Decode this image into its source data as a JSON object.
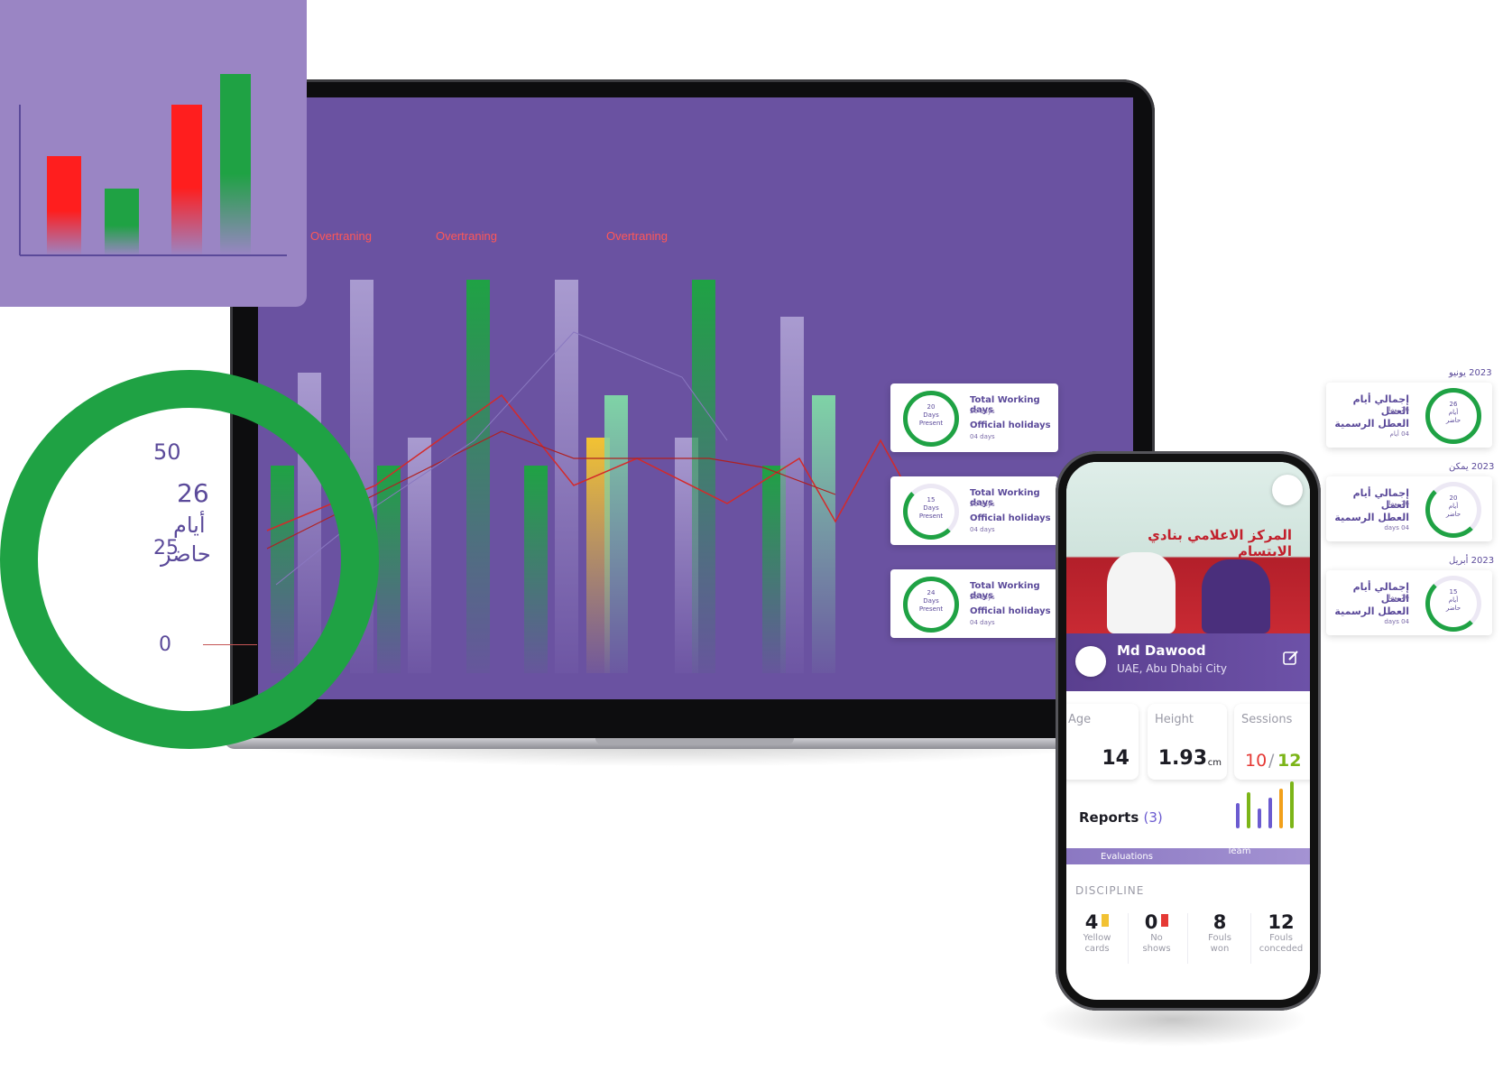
{
  "colors": {
    "brand_purple": "#6a52a1",
    "green": "#1fa244",
    "red": "#ff1e1e",
    "yellow": "#f2c233",
    "lavender": "#9a85c4",
    "ink": "#5b4a9a"
  },
  "laptop": {
    "overtraining_labels": [
      "Overtraning",
      "Overtraning",
      "Overtraning"
    ]
  },
  "big_ring": {
    "tick_top": "50",
    "tick_mid": "25",
    "tick_bottom": "0",
    "value": "26",
    "unit_line1": "أيام",
    "unit_line2": "حاضر"
  },
  "attendance_cards": [
    {
      "ring_line1": "20",
      "ring_line2": "Days",
      "ring_line3": "Present",
      "working_label": "Total Working days",
      "working_value": "26 days",
      "holiday_label": "Official holidays",
      "holiday_value": "04 days"
    },
    {
      "ring_line1": "15",
      "ring_line2": "Days",
      "ring_line3": "Present",
      "working_label": "Total Working days",
      "working_value": "26 days",
      "holiday_label": "Official holidays",
      "holiday_value": "04 days"
    },
    {
      "ring_line1": "24",
      "ring_line2": "Days",
      "ring_line3": "Present",
      "working_label": "Total Working days",
      "working_value": "26 days",
      "holiday_label": "Official holidays",
      "holiday_value": "04 days"
    }
  ],
  "arabic_cards": [
    {
      "date": "2023 يونيو",
      "ring_line1": "26",
      "ring_line2": "أيام",
      "ring_line3": "حاضر",
      "working_label": "إجمالي أيام العمل",
      "working_value": "26 يوما",
      "holiday_label": "العطل الرسمية",
      "holiday_value": "04 أيام"
    },
    {
      "date": "2023 يمكن",
      "ring_line1": "20",
      "ring_line2": "أيام",
      "ring_line3": "حاضر",
      "working_label": "إجمالي أيام العمل",
      "working_value": "26 يوما",
      "holiday_label": "العطل الرسمية",
      "holiday_value": "04 days"
    },
    {
      "date": "2023 أبريل",
      "ring_line1": "15",
      "ring_line2": "أيام",
      "ring_line3": "حاضر",
      "working_label": "إجمالي أيام العمل",
      "working_value": "26 يوما",
      "holiday_label": "العطل الرسمية",
      "holiday_value": "04 days"
    }
  ],
  "phone": {
    "banner_text": "المركز الاعلامي بنادي الابتسام",
    "profile": {
      "name": "Md Dawood",
      "location": "UAE, Abu Dhabi City"
    },
    "stats": [
      {
        "label": "Age",
        "value": "14"
      },
      {
        "label": "Height",
        "value": "1.93",
        "unit": "cm"
      },
      {
        "label": "Sessions",
        "value_a": "10",
        "sep": "/",
        "value_b": "12"
      }
    ],
    "reports": {
      "title": "Reports",
      "count": "(3)"
    },
    "tabs": [
      "Evaluations",
      "Team"
    ],
    "discipline": {
      "title": "DISCIPLINE",
      "items": [
        {
          "value": "4",
          "line1": "Yellow",
          "line2": "cards",
          "icon": "yellow-card-icon"
        },
        {
          "value": "0",
          "line1": "No",
          "line2": "shows",
          "icon": "red-card-icon"
        },
        {
          "value": "8",
          "line1": "Fouls",
          "line2": "won"
        },
        {
          "value": "12",
          "line1": "Fouls",
          "line2": "conceded"
        }
      ]
    }
  }
}
